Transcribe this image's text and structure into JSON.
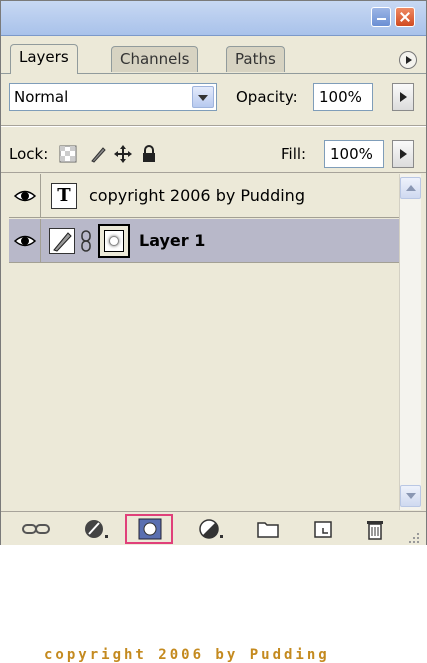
{
  "window": {
    "minimize_icon": "minimize-icon",
    "close_icon": "close-icon"
  },
  "tabs": [
    {
      "label": "Layers",
      "active": true
    },
    {
      "label": "Channels",
      "active": false
    },
    {
      "label": "Paths",
      "active": false
    }
  ],
  "blend": {
    "mode": "Normal",
    "opacity_label": "Opacity:",
    "opacity_value": "100%"
  },
  "lock": {
    "label": "Lock:",
    "icons": [
      "lock-transparent-pixels-icon",
      "lock-image-pixels-icon",
      "lock-position-icon",
      "lock-all-icon"
    ],
    "fill_label": "Fill:",
    "fill_value": "100%"
  },
  "layers": [
    {
      "name": "copyright 2006 by Pudding",
      "type": "text",
      "visible": true,
      "selected": false
    },
    {
      "name": "Layer 1",
      "type": "pixel-with-mask",
      "visible": true,
      "selected": true
    }
  ],
  "canvas_text": "copyright 2006 by Pudding",
  "toolbar": {
    "icons": [
      "link-layers-icon",
      "layer-style-icon",
      "add-layer-mask-icon",
      "adjustment-layer-icon",
      "new-group-icon",
      "new-layer-icon",
      "delete-layer-icon"
    ],
    "highlighted": "add-layer-mask-icon",
    "highlight_color": "#e0407a"
  },
  "colors": {
    "panel_bg": "#ece9d8",
    "selected_row": "#b8b8c9",
    "watermark": "#c48a1f"
  }
}
